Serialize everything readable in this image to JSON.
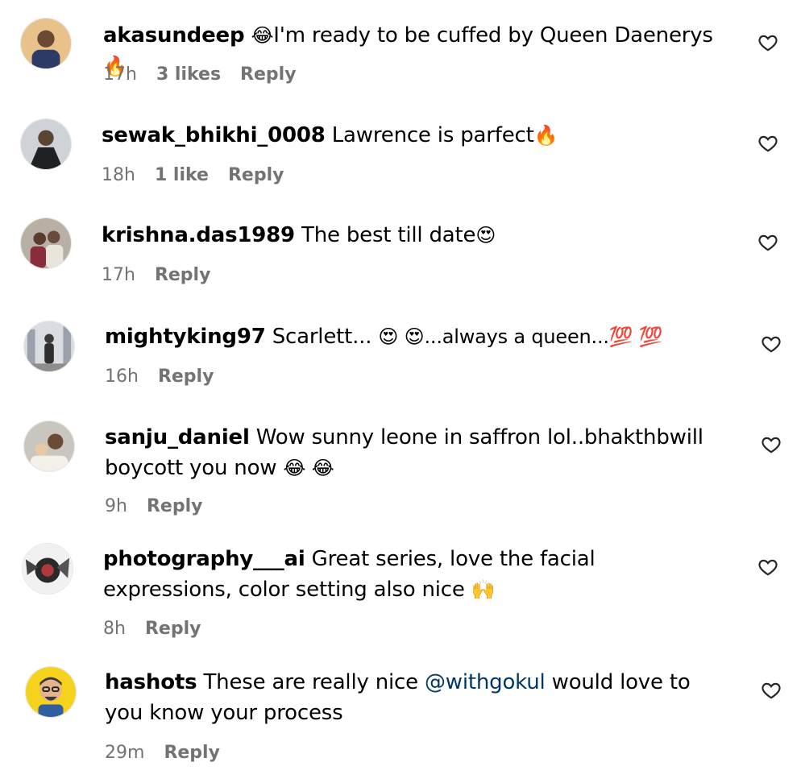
{
  "comments": [
    {
      "username": "akasundeep",
      "pre": "😂",
      "text": "I'm ready to be cuffed by Queen Daenerys",
      "post": "🔥",
      "time": "17h",
      "likes": "3 likes",
      "reply": "Reply"
    },
    {
      "username": "sewak_bhikhi_0008",
      "pre": "",
      "text": "Lawrence is parfect",
      "post": "🔥",
      "time": "18h",
      "likes": "1 like",
      "reply": "Reply"
    },
    {
      "username": "krishna.das1989",
      "pre": "",
      "text": "The best till date",
      "post": "😍",
      "time": "17h",
      "likes": "",
      "reply": "Reply"
    },
    {
      "username": "mightyking97",
      "pre": "",
      "text": "Scarlett... ",
      "post": "😍 😍...always a queen...💯 💯",
      "time": "16h",
      "likes": "",
      "reply": "Reply"
    },
    {
      "username": "sanju_daniel",
      "pre": "",
      "text": "Wow sunny leone in saffron lol..bhakthbwill boycott you now",
      "post": "😂 😂",
      "time": "9h",
      "likes": "",
      "reply": "Reply"
    },
    {
      "username": "photography___ai",
      "pre": "",
      "text": "Great series, love the facial expressions, color setting also nice",
      "post": "🙌",
      "time": "8h",
      "likes": "",
      "reply": "Reply"
    },
    {
      "username": "hashots",
      "pre": "",
      "text": "These are really nice",
      "mention": "@withgokul",
      "text2": "would love to you know your process",
      "post": "",
      "time": "29m",
      "likes": "",
      "reply": "Reply"
    }
  ],
  "icons": {
    "like": "heart-outline-icon"
  },
  "colors": {
    "meta": "#737373",
    "mention": "#00376b"
  }
}
